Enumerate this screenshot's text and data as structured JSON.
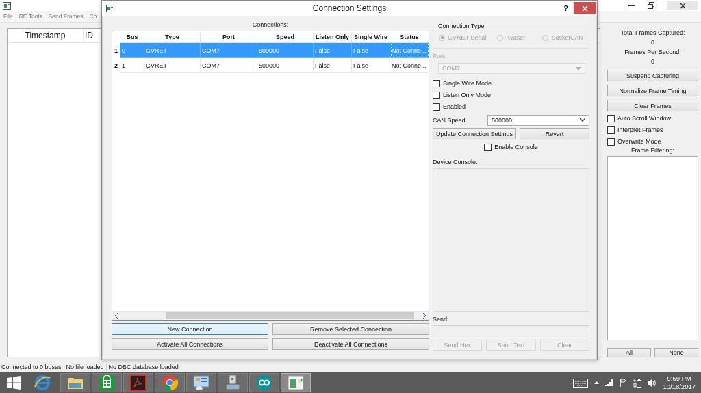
{
  "main_window": {
    "menu": [
      "File",
      "RE Tools",
      "Send Frames",
      "Co"
    ],
    "columns": [
      "Timestamp",
      "ID"
    ],
    "stats": [
      {
        "label": "Total Frames Captured:",
        "value": "0"
      },
      {
        "label": "Frames Per Second:",
        "value": "0"
      }
    ],
    "buttons": [
      "Suspend Capturing",
      "Normalize Frame Timing",
      "Clear Frames"
    ],
    "options": [
      {
        "label": "Auto Scroll Window",
        "checked": false
      },
      {
        "label": "Interpret Frames",
        "checked": false
      },
      {
        "label": "Overwrite Mode",
        "checked": false
      }
    ],
    "filter_label": "Frame Filtering:",
    "filter_buttons": [
      "All",
      "None"
    ]
  },
  "dialog": {
    "title": "Connection Settings",
    "help": "?",
    "connections_label": "Connections:",
    "table": {
      "columns": [
        "Bus",
        "Type",
        "Port",
        "Speed",
        "Listen Only",
        "Single Wire",
        "Status"
      ],
      "rows": [
        {
          "number": "1",
          "selected": true,
          "cells": [
            "0",
            "GVRET",
            "COM7",
            "500000",
            "False",
            "False",
            "Not Conne..."
          ]
        },
        {
          "number": "2",
          "selected": false,
          "cells": [
            "1",
            "GVRET",
            "COM7",
            "500000",
            "False",
            "False",
            "Not Conne..."
          ]
        }
      ]
    },
    "buttons": [
      {
        "label": "New Connection",
        "focused": true
      },
      {
        "label": "Remove Selected Connection",
        "focused": false
      },
      {
        "label": "Activate All Connections",
        "focused": false
      },
      {
        "label": "Deactivate All Connections",
        "focused": false
      }
    ],
    "connection_type": {
      "title": "Connection Type",
      "disabled": true,
      "options": [
        {
          "label": "GVRET Serial",
          "selected": true
        },
        {
          "label": "Kvaser",
          "selected": false
        },
        {
          "label": "SocketCAN",
          "selected": false
        }
      ]
    },
    "port": {
      "label": "Port:",
      "value": "COM7",
      "disabled": true
    },
    "options": [
      {
        "label": "Single Wire Mode",
        "checked": false
      },
      {
        "label": "Listen Only Mode",
        "checked": false
      },
      {
        "label": "Enabled",
        "checked": false
      }
    ],
    "can_speed": {
      "label": "CAN Speed",
      "value": "500000"
    },
    "action_buttons": [
      "Update Connection Settings",
      "Revert"
    ],
    "enable_console": {
      "label": "Enable Console",
      "checked": false
    },
    "console": {
      "label": "Device Console:",
      "disabled": true
    },
    "send": {
      "label": "Send:",
      "disabled": true,
      "buttons": [
        "Send Hex",
        "Send Text",
        "Clear"
      ]
    }
  },
  "status_bar": [
    "Connected to 0 buses",
    "No file loaded",
    "No DBC database loaded"
  ],
  "taskbar": {
    "apps": [
      {
        "kind": "browser",
        "active": false
      },
      {
        "kind": "folder",
        "active": false
      },
      {
        "kind": "store",
        "active": false
      },
      {
        "kind": "pdf",
        "active": false
      },
      {
        "kind": "chrome",
        "active": false
      },
      {
        "kind": "panel",
        "active": false
      },
      {
        "kind": "machine",
        "active": false
      },
      {
        "kind": "infinity",
        "active": false
      },
      {
        "kind": "window",
        "active": true
      }
    ],
    "time": "9:59 PM",
    "date": "10/18/2017"
  }
}
